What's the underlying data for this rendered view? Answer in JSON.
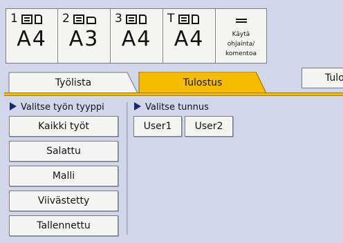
{
  "trays": [
    {
      "num": "1",
      "size": "A4",
      "paper_orientation": "portrait"
    },
    {
      "num": "2",
      "size": "A3",
      "paper_orientation": "landscape"
    },
    {
      "num": "3",
      "size": "A4",
      "paper_orientation": "portrait"
    },
    {
      "num": "T",
      "size": "A4",
      "paper_orientation": "portrait"
    }
  ],
  "command": {
    "line1": "Käytä",
    "line2": "ohjainta/",
    "line3": "komentoa",
    "icon": "list-icon"
  },
  "tabs": {
    "tyolista": "Työlista",
    "tulostus": "Tulostus",
    "right": "Tulo"
  },
  "colors": {
    "accent": "#f6bc00",
    "background": "#d2d6ea"
  },
  "job_type": {
    "title": "Valitse työn tyyppi",
    "options": [
      "Kaikki työt",
      "Salattu",
      "Malli",
      "Viivästetty",
      "Tallennettu"
    ]
  },
  "user_id": {
    "title": "Valitse tunnus",
    "users": [
      "User1",
      "User2"
    ]
  }
}
